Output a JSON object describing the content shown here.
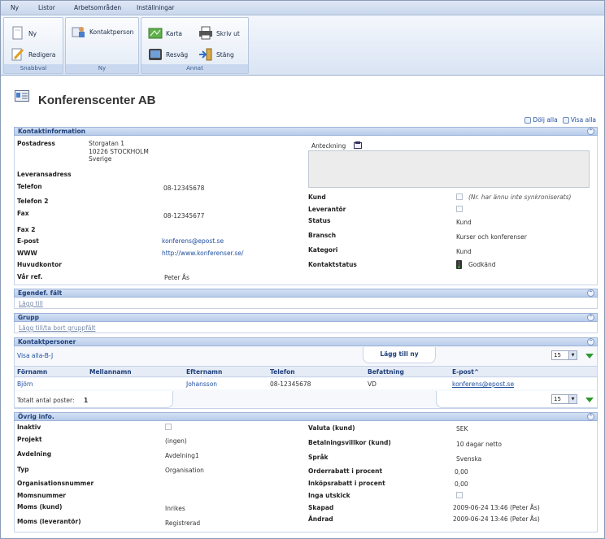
{
  "menu": [
    "Ny",
    "Listor",
    "Arbetsområden",
    "Inställningar"
  ],
  "ribbon": {
    "groups": [
      {
        "label": "Snabbval",
        "buttons": [
          "Ny",
          "Redigera"
        ]
      },
      {
        "label": "Ny",
        "buttons": [
          "Kontaktperson"
        ]
      },
      {
        "label": "Annat",
        "buttons": [
          "Karta",
          "Skriv ut",
          "Resväg",
          "Stäng"
        ]
      }
    ]
  },
  "page_title": "Konferenscenter AB",
  "toggle": {
    "hide_all": "Dölj alla",
    "show_all": "Visa alla"
  },
  "kontakt": {
    "header": "Kontaktinformation",
    "postadress_label": "Postadress",
    "postadress_lines": [
      "Storgatan 1",
      "10226 STOCKHOLM",
      "Sverige"
    ],
    "leveransadress_label": "Leveransadress",
    "telefon_label": "Telefon",
    "telefon": "08-12345678",
    "telefon2_label": "Telefon 2",
    "fax_label": "Fax",
    "fax": "08-12345677",
    "fax2_label": "Fax 2",
    "epost_label": "E-post",
    "epost": "konferens@epost.se",
    "www_label": "WWW",
    "www": "http://www.konferenser.se/",
    "huvudkontor_label": "Huvudkontor",
    "varref_label": "Vår ref.",
    "varref": "Peter Ås",
    "anteckning_label": "Anteckning",
    "kund_label": "Kund",
    "kund_note": "(Nr. har ännu inte synkroniserats)",
    "leverantor_label": "Leverantör",
    "status_label": "Status",
    "status": "Kund",
    "bransch_label": "Bransch",
    "bransch": "Kurser och konferenser",
    "kategori_label": "Kategori",
    "kategori": "Kund",
    "kontaktstatus_label": "Kontaktstatus",
    "kontaktstatus": "Godkänd"
  },
  "egendef": {
    "header": "Egendef. fält",
    "link": "Lägg till"
  },
  "grupp": {
    "header": "Grupp",
    "link": "Lägg till/ta bort gruppfält"
  },
  "kontaktpersoner": {
    "header": "Kontaktpersoner",
    "filter": "Visa alla-B-J",
    "add_button": "Lägg till ny",
    "page_size": "15",
    "columns": [
      "Förnamn",
      "Mellannamn",
      "Efternamn",
      "Telefon",
      "Befattning",
      "E-post"
    ],
    "rows": [
      {
        "fornamn": "Björn",
        "mellannamn": "",
        "efternamn": "Johansson",
        "telefon": "08-12345678",
        "befattning": "VD",
        "epost": "konferens@epost.se"
      }
    ],
    "total_label": "Totalt antal poster:",
    "total": "1"
  },
  "ovrig": {
    "header": "Övrig info.",
    "left": [
      {
        "label": "Inaktiv",
        "value": ""
      },
      {
        "label": "Projekt",
        "value": "(ingen)"
      },
      {
        "label": "Avdelning",
        "value": "Avdelning1"
      },
      {
        "label": "Typ",
        "value": "Organisation"
      },
      {
        "label": "Organisationsnummer",
        "value": ""
      },
      {
        "label": "Momsnummer",
        "value": ""
      },
      {
        "label": "Moms (kund)",
        "value": "Inrikes"
      },
      {
        "label": "Moms (leverantör)",
        "value": "Registrerad"
      }
    ],
    "right": [
      {
        "label": "Valuta (kund)",
        "value": "SEK"
      },
      {
        "label": "Betalningsvillkor (kund)",
        "value": "10 dagar netto"
      },
      {
        "label": "Språk",
        "value": "Svenska"
      },
      {
        "label": "Orderrabatt i procent",
        "value": "0,00"
      },
      {
        "label": "Inköpsrabatt i procent",
        "value": "0,00"
      },
      {
        "label": "Inga utskick",
        "value": ""
      },
      {
        "label": "Skapad",
        "value": "2009-06-24 13:46 (Peter Ås)"
      },
      {
        "label": "Ändrad",
        "value": "2009-06-24 13:46 (Peter Ås)"
      }
    ]
  }
}
